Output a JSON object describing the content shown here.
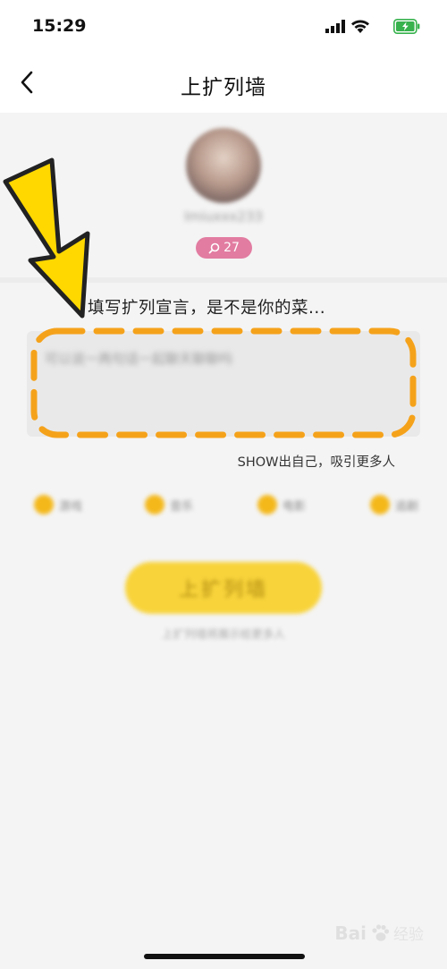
{
  "status_bar": {
    "time": "15:29"
  },
  "nav": {
    "title": "上扩列墙"
  },
  "profile": {
    "username": "Imiuxxx233",
    "bubble_count": "27"
  },
  "declaration": {
    "prompt": "填写扩列宣言，是不是你的菜...",
    "placeholder": "可以说一两句话一起聊天聊聊吗",
    "hint": "SHOW出自己，吸引更多人"
  },
  "tags": [
    "游戏",
    "音乐",
    "电影",
    "追剧"
  ],
  "submit": {
    "label": "上扩列墙",
    "footnote": "上扩列墙将展示给更多人"
  },
  "watermark": {
    "brand": "Bai",
    "suffix": "经验"
  },
  "colors": {
    "accent_yellow": "#f8d33a",
    "badge_pink": "#e27ca1",
    "highlight_orange": "#f5a21b",
    "arrow_yellow": "#ffd800"
  }
}
